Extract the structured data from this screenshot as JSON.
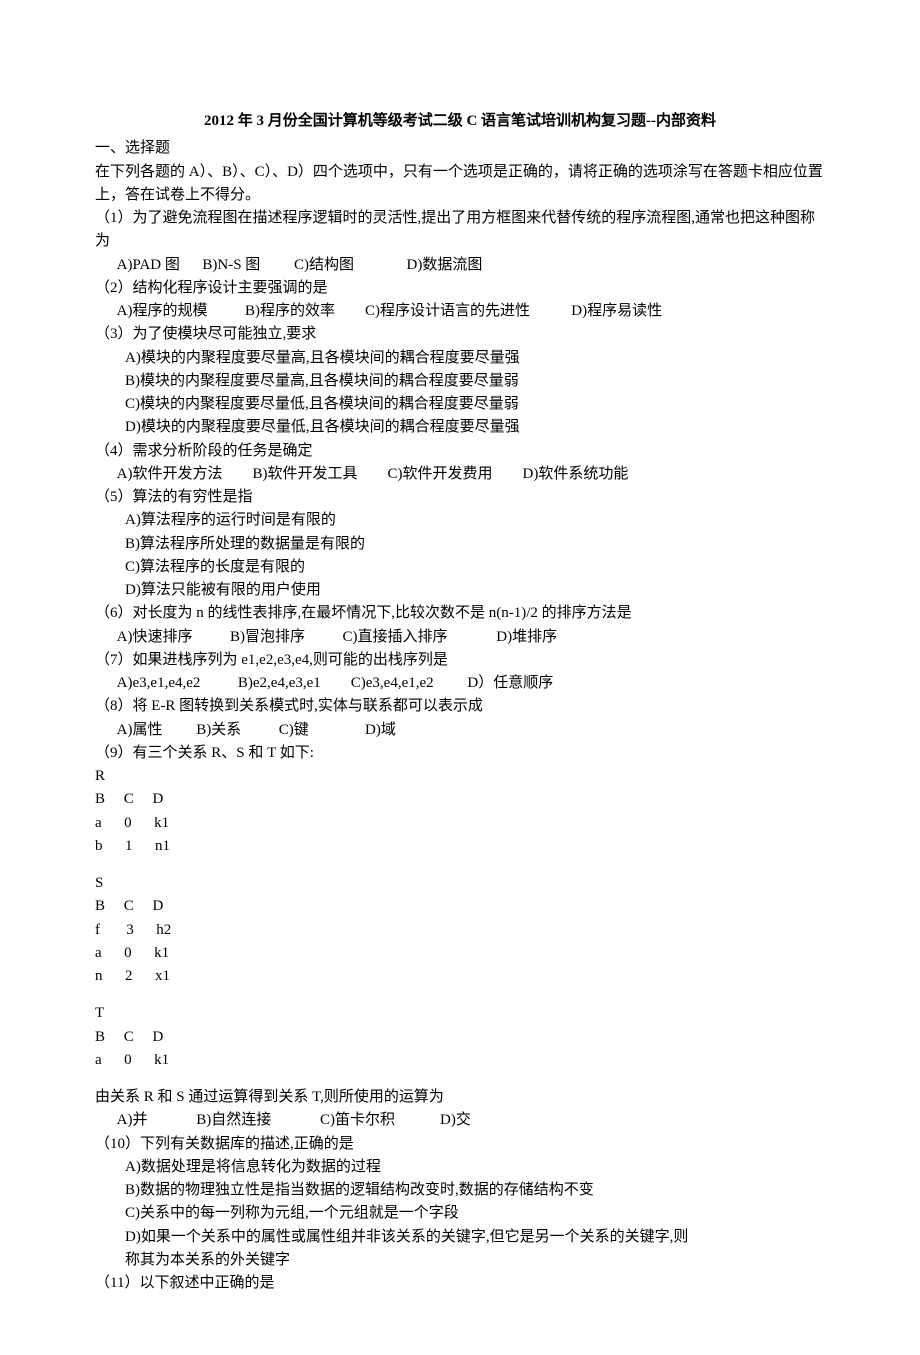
{
  "title": "2012 年 3 月份全国计算机等级考试二级 C 语言笔试培训机构复习题--内部资料",
  "section1": "一、选择题",
  "instructions": "在下列各题的 A）、B）、C）、D）四个选项中，只有一个选项是正确的，请将正确的选项涂写在答题卡相应位置上，答在试卷上不得分。",
  "q1": {
    "stem": "（1）为了避免流程图在描述程序逻辑时的灵活性,提出了用方框图来代替传统的程序流程图,通常也把这种图称为",
    "opts": "      A)PAD 图      B)N-S 图         C)结构图              D)数据流图"
  },
  "q2": {
    "stem": "（2）结构化程序设计主要强调的是",
    "opts": "      A)程序的规模          B)程序的效率        C)程序设计语言的先进性           D)程序易读性"
  },
  "q3": {
    "stem": "（3）为了使模块尽可能独立,要求",
    "a": "A)模块的内聚程度要尽量高,且各模块间的耦合程度要尽量强",
    "b": "B)模块的内聚程度要尽量高,且各模块间的耦合程度要尽量弱",
    "c": "C)模块的内聚程度要尽量低,且各模块间的耦合程度要尽量弱",
    "d": "D)模块的内聚程度要尽量低,且各模块间的耦合程度要尽量强"
  },
  "q4": {
    "stem": "（4）需求分析阶段的任务是确定",
    "opts": "      A)软件开发方法        B)软件开发工具        C)软件开发费用        D)软件系统功能"
  },
  "q5": {
    "stem": "（5）算法的有穷性是指",
    "a": "A)算法程序的运行时间是有限的",
    "b": "B)算法程序所处理的数据量是有限的",
    "c": "C)算法程序的长度是有限的",
    "d": "D)算法只能被有限的用户使用"
  },
  "q6": {
    "stem": "（6）对长度为 n 的线性表排序,在最坏情况下,比较次数不是 n(n-1)/2 的排序方法是",
    "opts": "      A)快速排序          B)冒泡排序          C)直接插入排序             D)堆排序"
  },
  "q7": {
    "stem": "（7）如果进栈序列为 e1,e2,e3,e4,则可能的出栈序列是",
    "opts": "      A)e3,e1,e4,e2          B)e2,e4,e3,e1        C)e3,e4,e1,e2         D）任意顺序"
  },
  "q8": {
    "stem": "（8）将 E-R 图转换到关系模式时,实体与联系都可以表示成",
    "opts": "      A)属性         B)关系          C)键               D)域"
  },
  "q9": {
    "stem": "（9）有三个关系 R、S 和 T 如下:",
    "tableR": "R\nB     C     D\na      0      k1\nb      1      n1",
    "tableS": "S\nB     C     D\nf       3      h2\na      0      k1\nn      2      x1",
    "tableT": "T\nB     C     D\na      0      k1",
    "after": "由关系 R 和 S 通过运算得到关系 T,则所使用的运算为",
    "opts": "      A)并             B)自然连接             C)笛卡尔积            D)交"
  },
  "q10": {
    "stem": "（10）下列有关数据库的描述,正确的是",
    "a": "A)数据处理是将信息转化为数据的过程",
    "b": "B)数据的物理独立性是指当数据的逻辑结构改变时,数据的存储结构不变",
    "c": "C)关系中的每一列称为元组,一个元组就是一个字段",
    "d1": "D)如果一个关系中的属性或属性组并非该关系的关键字,但它是另一个关系的关键字,则",
    "d2": "称其为本关系的外关键字"
  },
  "q11": {
    "stem": "（11）以下叙述中正确的是"
  }
}
